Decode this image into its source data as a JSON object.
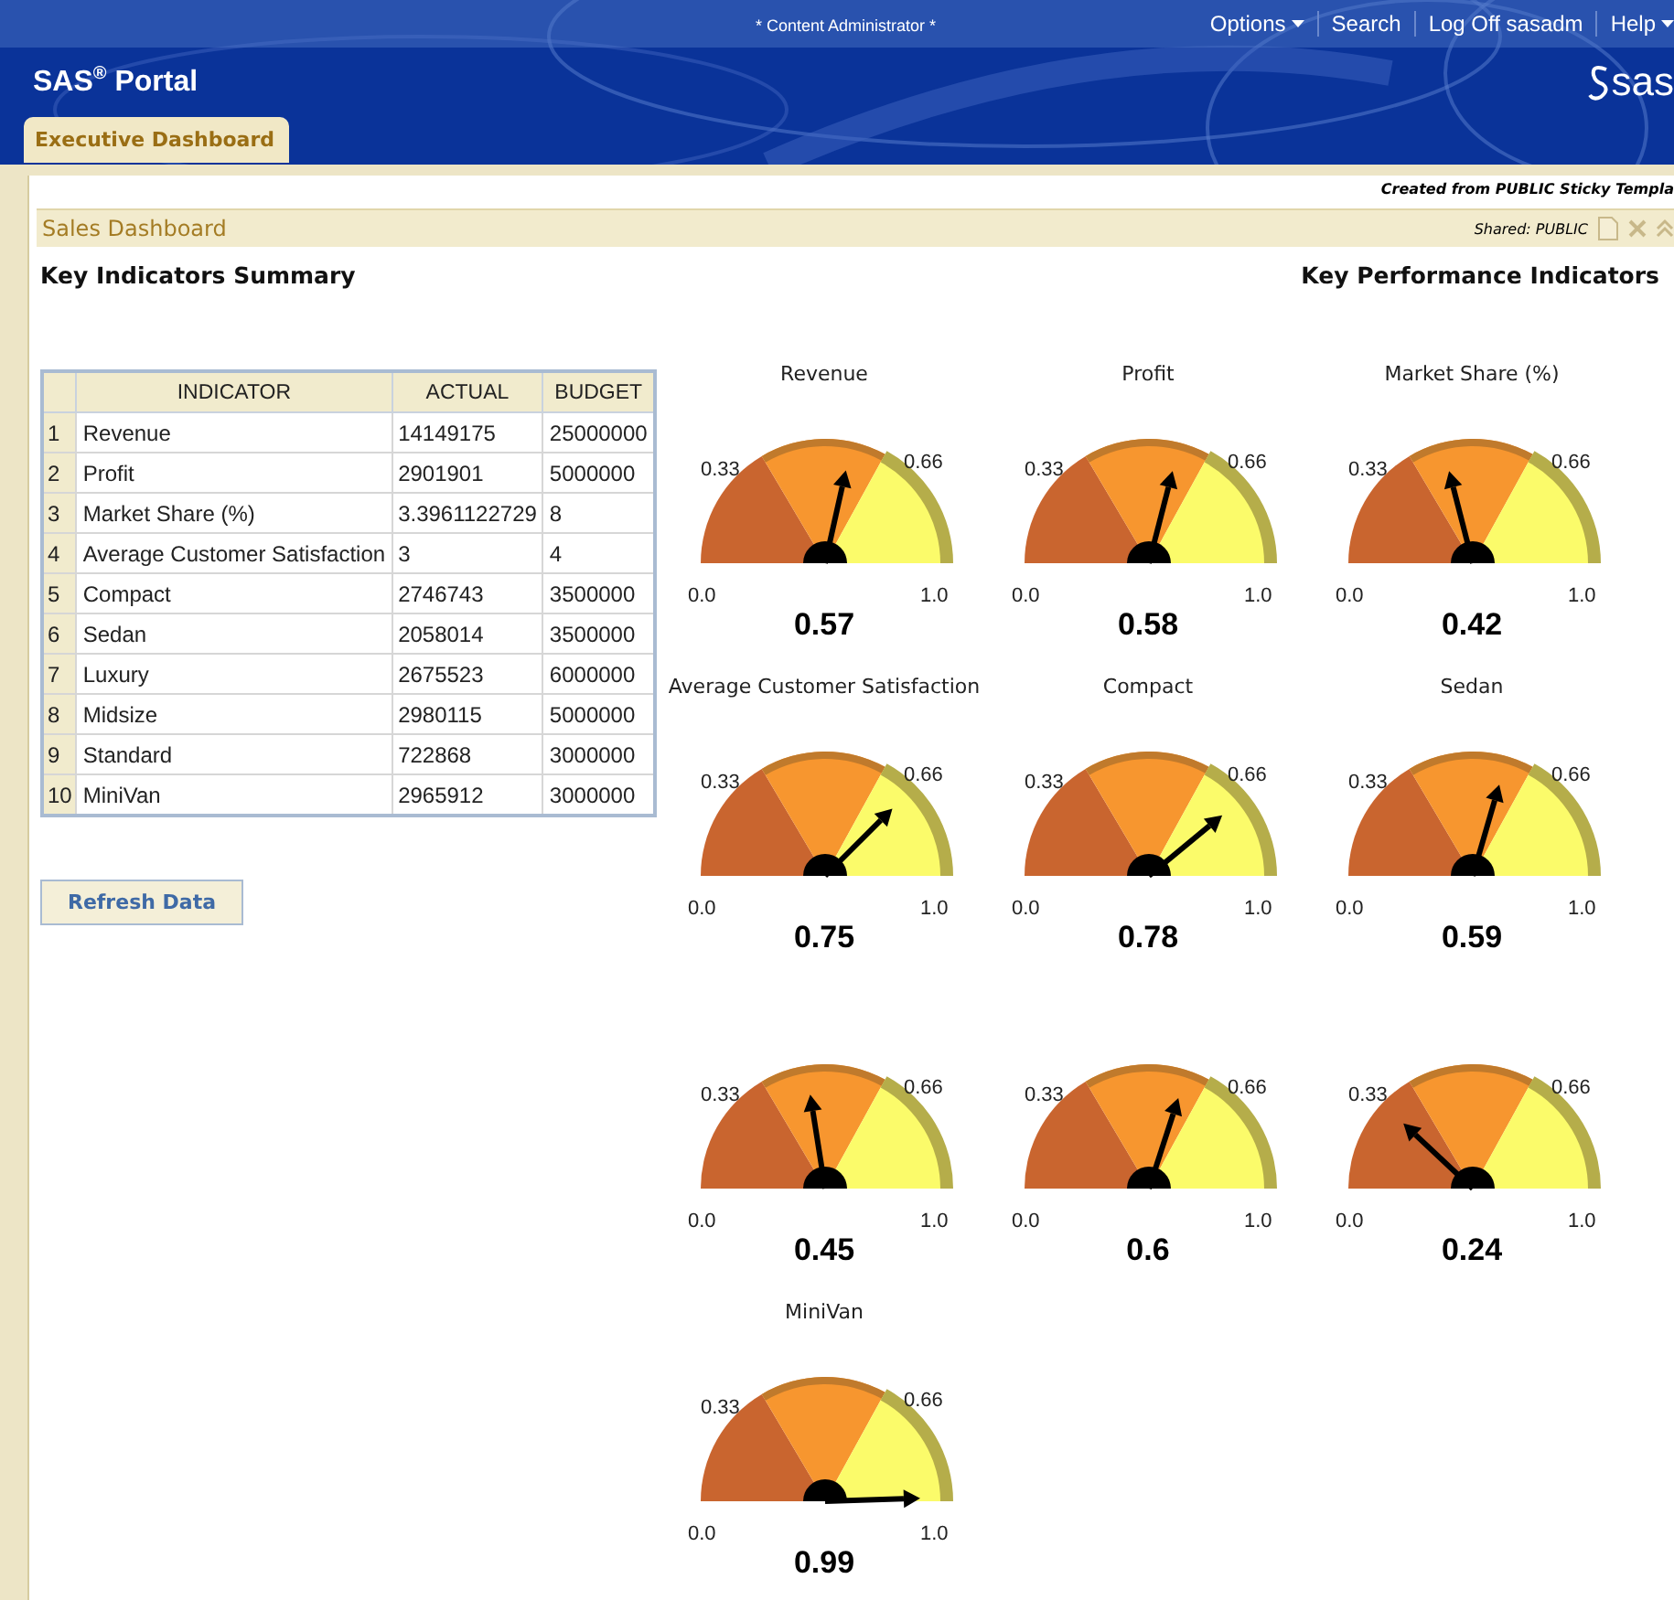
{
  "header": {
    "role": "* Content Administrator *",
    "links": [
      {
        "label": "Options",
        "dropdown": true
      },
      {
        "label": "Search",
        "dropdown": false
      },
      {
        "label": "Log Off sasadm",
        "dropdown": false
      },
      {
        "label": "Help",
        "dropdown": true
      }
    ],
    "title": "SAS",
    "title_sup": "®",
    "title_rest": "Portal",
    "logo": "sas"
  },
  "tabs": [
    {
      "label": "Executive Dashboard",
      "selected": true
    }
  ],
  "template_note": "Created from PUBLIC Sticky Templa",
  "portlet": {
    "title": "Sales Dashboard",
    "shared": "Shared: PUBLIC"
  },
  "left": {
    "heading": "Key Indicators Summary",
    "table": {
      "columns": [
        "",
        "INDICATOR",
        "ACTUAL",
        "BUDGET"
      ],
      "rows": [
        [
          "1",
          "Revenue",
          "14149175",
          "25000000"
        ],
        [
          "2",
          "Profit",
          "2901901",
          "5000000"
        ],
        [
          "3",
          "Market Share (%)",
          "3.3961122729",
          "8"
        ],
        [
          "4",
          "Average Customer Satisfaction",
          "3",
          "4"
        ],
        [
          "5",
          "Compact",
          "2746743",
          "3500000"
        ],
        [
          "6",
          "Sedan",
          "2058014",
          "3500000"
        ],
        [
          "7",
          "Luxury",
          "2675523",
          "6000000"
        ],
        [
          "8",
          "Midsize",
          "2980115",
          "5000000"
        ],
        [
          "9",
          "Standard",
          "722868",
          "3000000"
        ],
        [
          "10",
          "MiniVan",
          "2965912",
          "3000000"
        ]
      ]
    },
    "button": "Refresh Data"
  },
  "right": {
    "heading": "Key Performance Indicators",
    "gauges": [
      {
        "title": "Revenue",
        "reading": "0.57",
        "ticks": [
          "0.33",
          "0.66",
          "0.0",
          "1.0"
        ]
      },
      {
        "title": "Profit",
        "reading": "0.58",
        "ticks": [
          "0.33",
          "0.66",
          "0.0",
          "1.0"
        ]
      },
      {
        "title": "Market Share (%)",
        "reading": "0.42",
        "ticks": [
          "0.33",
          "0.66",
          "0.0",
          "1.0"
        ]
      },
      {
        "title": "Average Customer Satisfaction",
        "reading": "0.75",
        "ticks": [
          "0.33",
          "0.66",
          "0.0",
          "1.0"
        ]
      },
      {
        "title": "Compact",
        "reading": "0.78",
        "ticks": [
          "0.33",
          "0.66",
          "0.0",
          "1.0"
        ]
      },
      {
        "title": "Sedan",
        "reading": "0.59",
        "ticks": [
          "0.33",
          "0.66",
          "0.0",
          "1.0"
        ]
      },
      {
        "reading": "0.45",
        "ticks": [
          "0.33",
          "0.66",
          "0.0",
          "1.0"
        ]
      },
      {
        "reading": "0.6",
        "ticks": [
          "0.33",
          "0.66",
          "0.0",
          "1.0"
        ]
      },
      {
        "reading": "0.24",
        "ticks": [
          "0.33",
          "0.66",
          "0.0",
          "1.0"
        ]
      },
      {
        "title": "MiniVan",
        "reading": "0.99",
        "ticks": [
          "0.33",
          "0.66",
          "0.0",
          "1.0"
        ]
      }
    ]
  }
}
